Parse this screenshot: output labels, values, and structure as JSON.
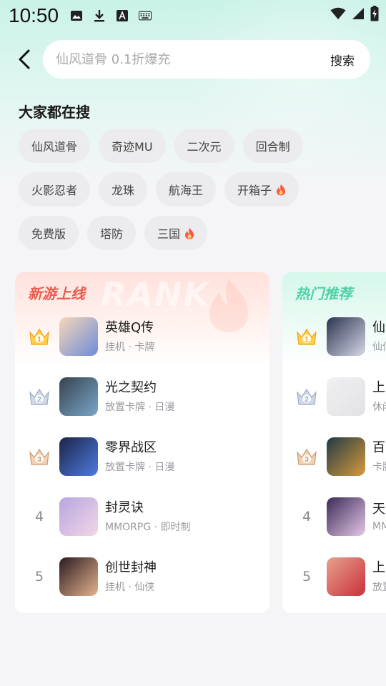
{
  "status_bar": {
    "time": "10:50",
    "icons": [
      "image-icon",
      "download-icon",
      "font-icon",
      "keyboard-icon"
    ],
    "right_icons": [
      "wifi-icon",
      "signal-icon",
      "battery-charging-icon"
    ]
  },
  "search": {
    "placeholder": "仙风道骨 0.1折爆充",
    "button_label": "搜索"
  },
  "hot_searches": {
    "title": "大家都在搜",
    "rows": [
      [
        {
          "label": "仙风道骨",
          "hot": false
        },
        {
          "label": "奇迹MU",
          "hot": false
        },
        {
          "label": "二次元",
          "hot": false
        },
        {
          "label": "回合制",
          "hot": false
        }
      ],
      [
        {
          "label": "火影忍者",
          "hot": false
        },
        {
          "label": "龙珠",
          "hot": false
        },
        {
          "label": "航海王",
          "hot": false
        },
        {
          "label": "开箱子",
          "hot": true
        }
      ],
      [
        {
          "label": "免费版",
          "hot": false
        },
        {
          "label": "塔防",
          "hot": false
        },
        {
          "label": "三国",
          "hot": true
        }
      ]
    ]
  },
  "colors": {
    "new_games_accent": "#ee5a4a",
    "hot_recommend_accent": "#4dd1a6",
    "fire": "#ff5a3c"
  },
  "new_games": {
    "title": "新游上线",
    "watermark": "RANK",
    "items": [
      {
        "rank": "1",
        "name": "英雄Q传",
        "tags": "挂机 · 卡牌"
      },
      {
        "rank": "2",
        "name": "光之契约",
        "tags": "放置卡牌 · 日漫"
      },
      {
        "rank": "3",
        "name": "零界战区",
        "tags": "放置卡牌 · 日漫"
      },
      {
        "rank": "4",
        "name": "封灵诀",
        "tags": "MMORPG · 即时制"
      },
      {
        "rank": "5",
        "name": "创世封神",
        "tags": "挂机 · 仙侠"
      }
    ]
  },
  "hot_recommend": {
    "title": "热门推荐",
    "items": [
      {
        "rank": "1",
        "name": "仙",
        "tags": "仙仙"
      },
      {
        "rank": "2",
        "name": "上",
        "tags": "休闲"
      },
      {
        "rank": "3",
        "name": "百",
        "tags": "卡牌"
      },
      {
        "rank": "4",
        "name": "天",
        "tags": "MM"
      },
      {
        "rank": "5",
        "name": "上",
        "tags": "放置"
      }
    ]
  }
}
